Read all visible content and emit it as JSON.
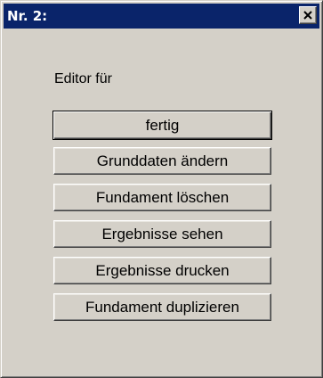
{
  "window": {
    "title": "Nr. 2:"
  },
  "editor": {
    "label": "Editor für",
    "buttons": [
      {
        "label": "fertig"
      },
      {
        "label": "Grunddaten ändern"
      },
      {
        "label": "Fundament löschen"
      },
      {
        "label": "Ergebnisse sehen"
      },
      {
        "label": "Ergebnisse drucken"
      },
      {
        "label": "Fundament duplizieren"
      }
    ]
  },
  "colors": {
    "titlebar": "#0a246a",
    "face": "#d4d0c8"
  },
  "icons": {
    "close": "close-icon"
  }
}
